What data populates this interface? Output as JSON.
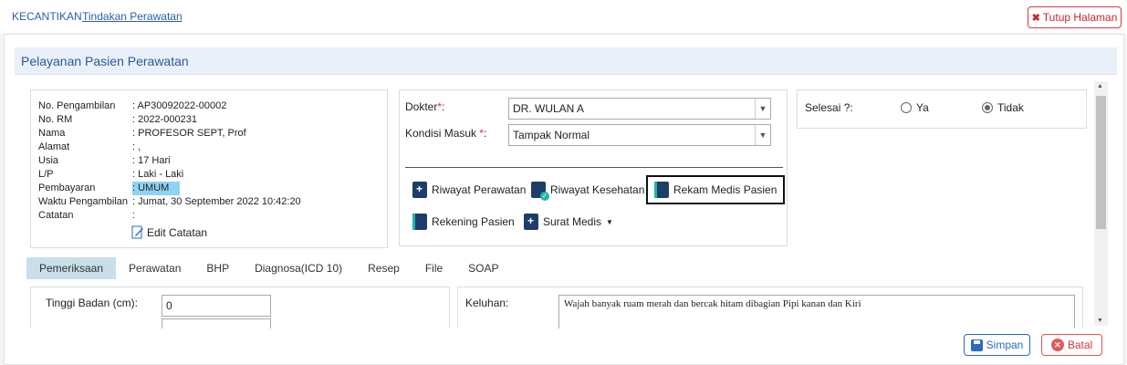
{
  "breadcrumb": {
    "root": "KECANTIKAN",
    "current": "Tindakan Perawatan"
  },
  "close_button": "Tutup Halaman",
  "panel_title": "Pelayanan Pasien Perawatan",
  "patient": [
    {
      "label": "No. Pengambilan",
      "value": ": AP30092022-00002"
    },
    {
      "label": "No. RM",
      "value": ": 2022-000231"
    },
    {
      "label": "Nama",
      "value": ": PROFESOR SEPT, Prof"
    },
    {
      "label": "Alamat",
      "value": ": ,"
    },
    {
      "label": "Usia",
      "value": ": 17 Hari"
    },
    {
      "label": "L/P",
      "value": ": Laki - Laki"
    },
    {
      "label": "Pembayaran",
      "value": ": UMUM"
    },
    {
      "label": "Waktu Pengambilan",
      "value": ": Jumat, 30 September 2022 10:42:20"
    },
    {
      "label": "Catatan",
      "value": ":"
    }
  ],
  "edit_note": "Edit Catatan",
  "form": {
    "doctor_label": "Dokter",
    "doctor_value": "DR. WULAN A",
    "condition_label": "Kondisi Masuk ",
    "condition_value": "Tampak Normal",
    "required_mark": "*",
    "suffix": ":"
  },
  "actions": {
    "riwayat_perawatan": "Riwayat Perawatan",
    "riwayat_kesehatan": "Riwayat Kesehatan",
    "rekam_medis": "Rekam Medis Pasien",
    "rekening": "Rekening Pasien",
    "surat_medis": "Surat Medis"
  },
  "done": {
    "label": "Selesai ?:",
    "yes": "Ya",
    "no": "Tidak",
    "selected": "no"
  },
  "tabs": [
    "Pemeriksaan",
    "Perawatan",
    "BHP",
    "Diagnosa(ICD 10)",
    "Resep",
    "File",
    "SOAP"
  ],
  "exam": {
    "height_label": "Tinggi Badan (cm):",
    "height_value": "0",
    "complaint_label": "Keluhan:",
    "complaint_value": "Wajah banyak ruam merah dan bercak hitam dibagian Pipi kanan dan Kiri"
  },
  "buttons": {
    "save": "Simpan",
    "cancel": "Batal"
  }
}
